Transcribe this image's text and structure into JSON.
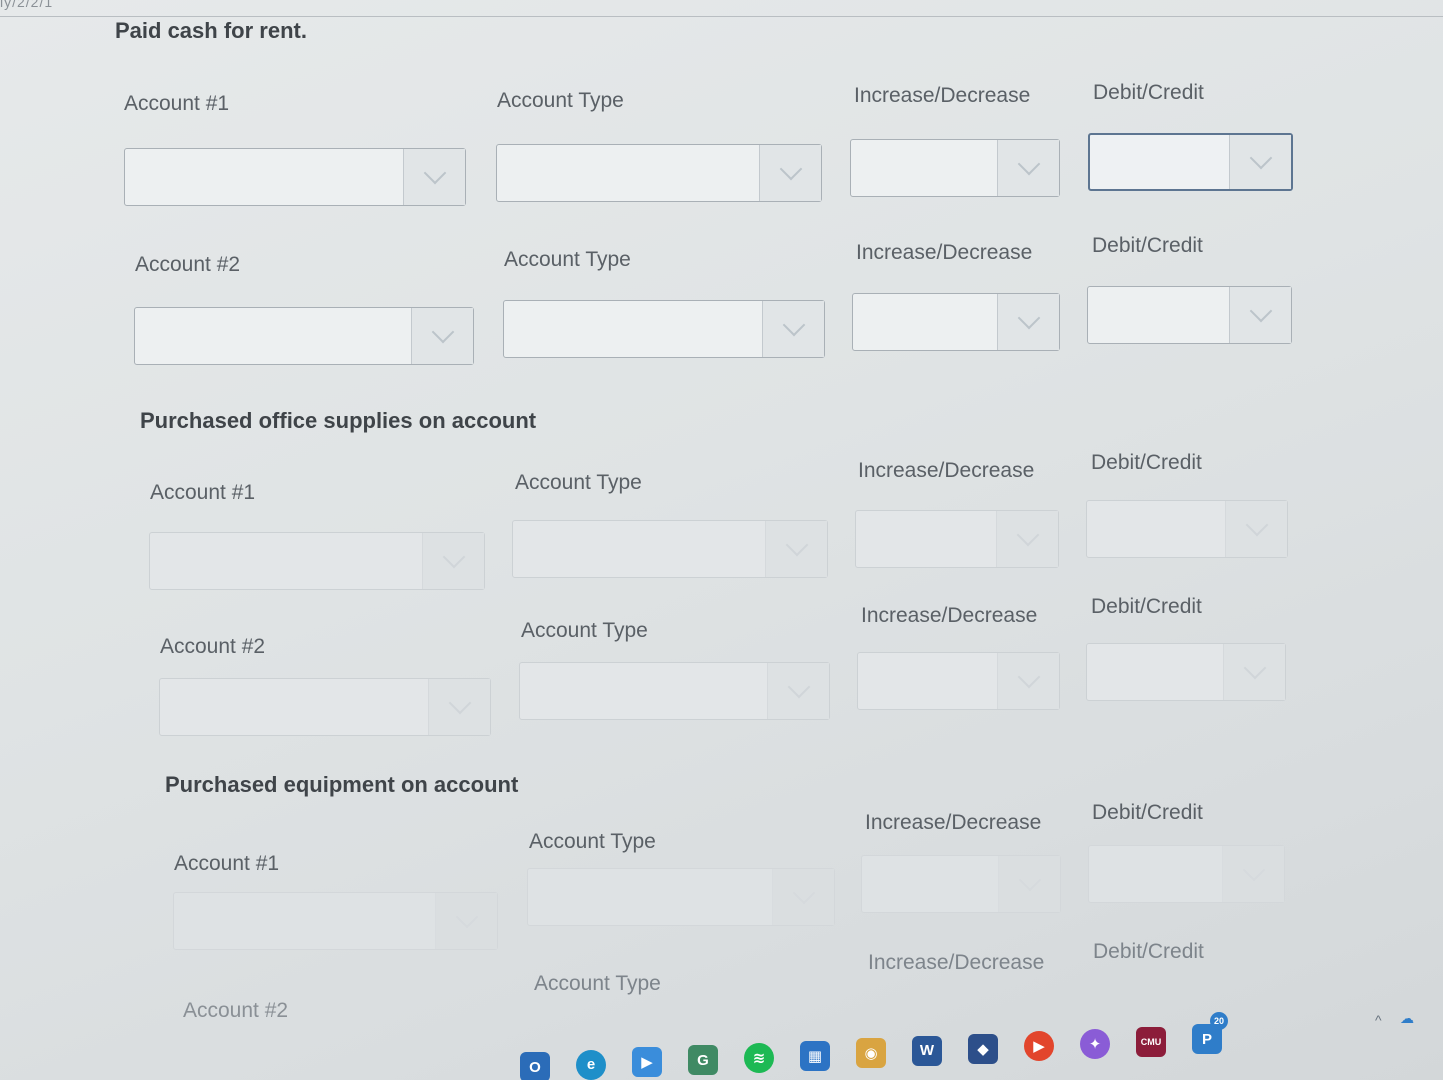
{
  "header": {
    "corner_text": "ly/2/2/1"
  },
  "sections": [
    {
      "title": "Paid cash for rent.",
      "rows": [
        {
          "account_label": "Account #1",
          "type_label": "Account Type",
          "incdec_label": "Increase/Decrease",
          "debcred_label": "Debit/Credit"
        },
        {
          "account_label": "Account #2",
          "type_label": "Account Type",
          "incdec_label": "Increase/Decrease",
          "debcred_label": "Debit/Credit"
        }
      ]
    },
    {
      "title": "Purchased office supplies on account",
      "rows": [
        {
          "account_label": "Account #1",
          "type_label": "Account Type",
          "incdec_label": "Increase/Decrease",
          "debcred_label": "Debit/Credit"
        },
        {
          "account_label": "Account #2",
          "type_label": "Account Type",
          "incdec_label": "Increase/Decrease",
          "debcred_label": "Debit/Credit"
        }
      ]
    },
    {
      "title": "Purchased equipment on account",
      "rows": [
        {
          "account_label": "Account #1",
          "type_label": "Account Type",
          "incdec_label": "Increase/Decrease",
          "debcred_label": "Debit/Credit"
        },
        {
          "account_label": "Account #2",
          "type_label": "Account Type",
          "incdec_label": "Increase/Decrease",
          "debcred_label": "Debit/Credit"
        }
      ]
    }
  ],
  "taskbar": {
    "icons": [
      {
        "name": "outlook-icon",
        "glyph": "O",
        "color": "#2b6cb8"
      },
      {
        "name": "edge-icon",
        "glyph": "e",
        "color": "#1e8fc9"
      },
      {
        "name": "zoom-icon",
        "glyph": "▶",
        "color": "#3a8ddb"
      },
      {
        "name": "grammarly-icon",
        "glyph": "G",
        "color": "#3f8a64"
      },
      {
        "name": "spotify-icon",
        "glyph": "≋",
        "color": "#1db954"
      },
      {
        "name": "store-icon",
        "glyph": "▦",
        "color": "#2c73c4"
      },
      {
        "name": "chrome-icon",
        "glyph": "◉",
        "color": "#d9a441"
      },
      {
        "name": "word-icon",
        "glyph": "W",
        "color": "#2b5797"
      },
      {
        "name": "app-icon",
        "glyph": "◆",
        "color": "#2d4f8a"
      },
      {
        "name": "media-player-icon",
        "glyph": "▶",
        "color": "#e2452c"
      },
      {
        "name": "messenger-icon",
        "glyph": "✦",
        "color": "#8a5cd6"
      },
      {
        "name": "cmu-icon",
        "glyph": "CMU",
        "color": "#8c1d3a"
      },
      {
        "name": "teams-icon",
        "glyph": "P",
        "color": "#2f7dc9"
      }
    ],
    "badge": "20"
  },
  "colors": {
    "focus_border": "#5d7591",
    "box_border": "#a9b0b6",
    "label_text": "#5a6066",
    "title_text": "#3f4449"
  }
}
